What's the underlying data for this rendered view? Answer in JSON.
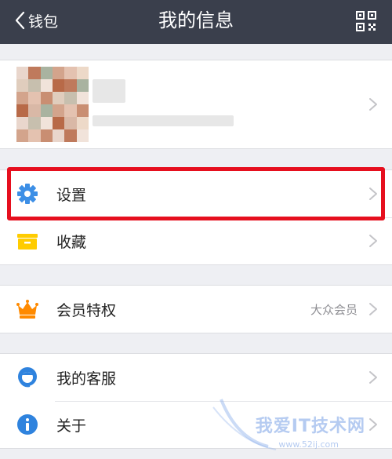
{
  "navbar": {
    "back_label": "钱包",
    "title": "我的信息",
    "qr_icon": "qr-code-icon"
  },
  "profile": {
    "avatar": "pixelated-avatar"
  },
  "groups": [
    {
      "items": [
        {
          "label": "设置",
          "icon": "gear-icon",
          "value": ""
        },
        {
          "label": "收藏",
          "icon": "folder-icon",
          "value": ""
        }
      ]
    },
    {
      "items": [
        {
          "label": "会员特权",
          "icon": "crown-icon",
          "value": "大众会员"
        }
      ]
    },
    {
      "items": [
        {
          "label": "我的客服",
          "icon": "customer-service-icon",
          "value": ""
        },
        {
          "label": "关于",
          "icon": "info-icon",
          "value": ""
        }
      ]
    }
  ],
  "watermark": {
    "text": "我爱IT技术网",
    "url": "www.52ij.com"
  },
  "colors": {
    "navbar": "#3a3f4c",
    "highlight": "#e60f1e",
    "gear": "#3d8fe6",
    "folder": "#ffcc00",
    "crown": "#ff8a00",
    "info": "#2f83de"
  }
}
